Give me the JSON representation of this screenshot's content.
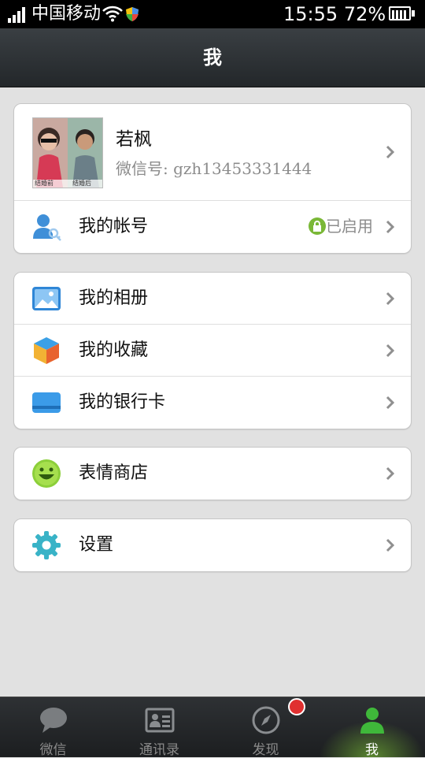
{
  "status_bar": {
    "carrier": "中国移动",
    "time": "15:55",
    "battery": "72%"
  },
  "header": {
    "title": "我"
  },
  "profile": {
    "name": "若枫",
    "wechat_id": "微信号: gzh13453331444",
    "avatar_captions": [
      "结婚前",
      "结婚后"
    ]
  },
  "account": {
    "label": "我的帐号",
    "status": "已启用"
  },
  "menu_group_1": [
    {
      "label": "我的相册",
      "icon": "album-icon"
    },
    {
      "label": "我的收藏",
      "icon": "favorites-icon"
    },
    {
      "label": "我的银行卡",
      "icon": "bank-card-icon"
    }
  ],
  "stickers": {
    "label": "表情商店",
    "icon": "smiley-icon"
  },
  "settings": {
    "label": "设置",
    "icon": "gear-icon"
  },
  "tabbar": {
    "tabs": [
      {
        "label": "微信",
        "icon": "chat-bubble-icon",
        "active": false
      },
      {
        "label": "通讯录",
        "icon": "contacts-card-icon",
        "active": false
      },
      {
        "label": "发现",
        "icon": "compass-icon",
        "active": false,
        "badge": true
      },
      {
        "label": "我",
        "icon": "person-icon",
        "active": true
      }
    ]
  },
  "colors": {
    "accent_green": "#7ab837",
    "badge_red": "#e03030",
    "background": "#e1e1e1"
  }
}
